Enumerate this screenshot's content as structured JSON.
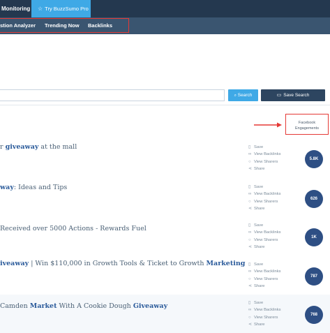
{
  "topnav": {
    "monitoring_label": "Monitoring",
    "pro_label": "Try BuzzSumo Pro"
  },
  "subnav": {
    "items": [
      "stion Analyzer",
      "Trending Now",
      "Backlinks"
    ]
  },
  "search": {
    "search_label": "Search",
    "save_label": "Save Search"
  },
  "facebook_header": {
    "line1": "Facebook",
    "line2": "Engagements"
  },
  "actions": {
    "save": "Save",
    "view_backlinks": "View Backlinks",
    "view_sharers": "View Sharers",
    "share": "Share"
  },
  "rows": [
    {
      "pre": "r ",
      "bold1": "giveaway",
      "mid": " at the mall",
      "bold2": "",
      "post": "",
      "engagements": "5.8K"
    },
    {
      "pre": "",
      "bold1": "way",
      "mid": ": Ideas and Tips",
      "bold2": "",
      "post": "",
      "engagements": "626"
    },
    {
      "pre": "Received over 5000 Actions - Rewards Fuel",
      "bold1": "",
      "mid": "",
      "bold2": "",
      "post": "",
      "engagements": "1K"
    },
    {
      "pre": "",
      "bold1": "iveaway",
      "mid": " | Win $110,000 in Growth Tools & Ticket to Growth ",
      "bold2": "Marketing",
      "post": "",
      "engagements": "787"
    },
    {
      "pre": "Camden ",
      "bold1": "Market",
      "mid": " With A Cookie Dough ",
      "bold2": "Giveaway",
      "post": "",
      "engagements": "768"
    }
  ],
  "colors": {
    "nav_dark": "#24384f",
    "subnav": "#3a5570",
    "pro_blue": "#3fa9e6",
    "badge": "#2e4f84",
    "annotation_red": "#e53935"
  }
}
